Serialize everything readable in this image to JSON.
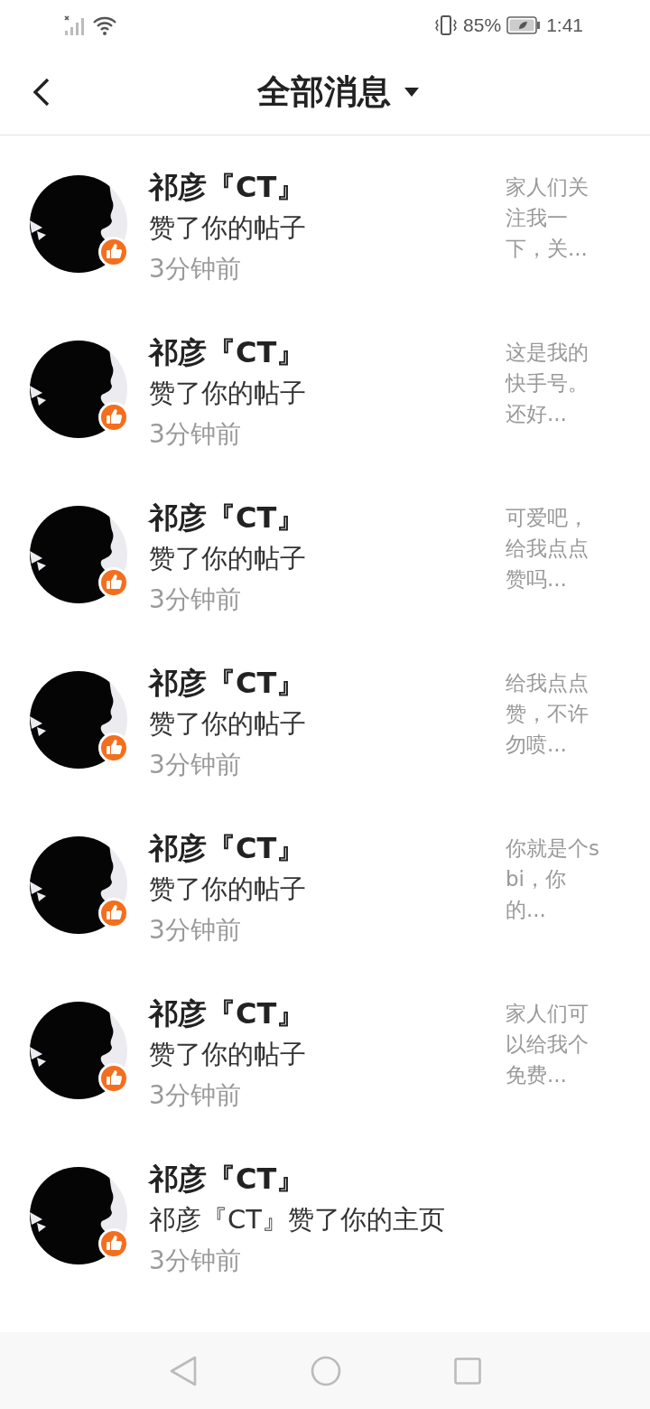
{
  "status_bar": {
    "battery": "85%",
    "time": "1:41"
  },
  "header": {
    "title": "全部消息"
  },
  "notifications": [
    {
      "name": "祁彦『CT』",
      "action": "赞了你的帖子",
      "time": "3分钟前",
      "preview": "家人们关注我一下，关..."
    },
    {
      "name": "祁彦『CT』",
      "action": "赞了你的帖子",
      "time": "3分钟前",
      "preview": "这是我的快手号。还好..."
    },
    {
      "name": "祁彦『CT』",
      "action": "赞了你的帖子",
      "time": "3分钟前",
      "preview": "可爱吧，给我点点赞吗..."
    },
    {
      "name": "祁彦『CT』",
      "action": "赞了你的帖子",
      "time": "3分钟前",
      "preview": "给我点点赞，不许勿喷..."
    },
    {
      "name": "祁彦『CT』",
      "action": "赞了你的帖子",
      "time": "3分钟前",
      "preview": "你就是个sbi，你的..."
    },
    {
      "name": "祁彦『CT』",
      "action": "赞了你的帖子",
      "time": "3分钟前",
      "preview": "家人们可以给我个免费..."
    },
    {
      "name": "祁彦『CT』",
      "action": "祁彦『CT』赞了你的主页",
      "time": "3分钟前"
    }
  ]
}
